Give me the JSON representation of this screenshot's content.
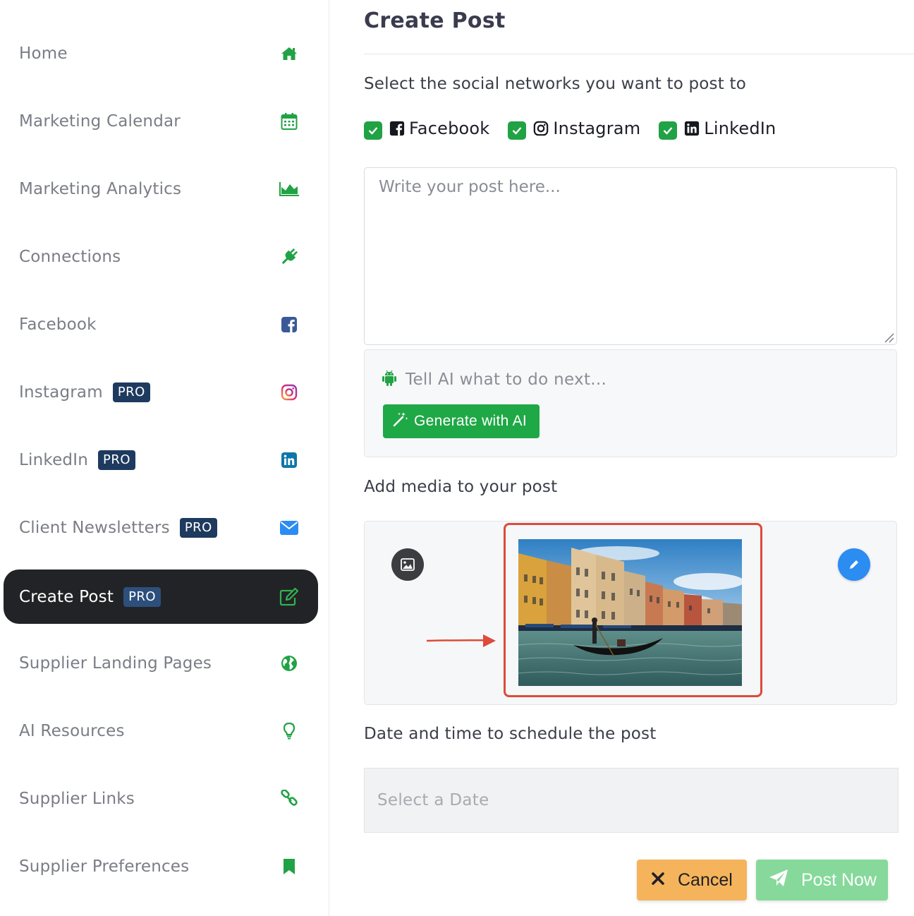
{
  "sidebar": {
    "items": [
      {
        "label": "Home",
        "icon": "home-icon",
        "pro": ""
      },
      {
        "label": "Marketing Calendar",
        "icon": "calendar-icon",
        "pro": ""
      },
      {
        "label": "Marketing Analytics",
        "icon": "area-chart-icon",
        "pro": ""
      },
      {
        "label": "Connections",
        "icon": "plug-icon",
        "pro": ""
      },
      {
        "label": "Facebook",
        "icon": "facebook-icon",
        "pro": ""
      },
      {
        "label": "Instagram",
        "icon": "instagram-icon",
        "pro": "PRO"
      },
      {
        "label": "LinkedIn",
        "icon": "linkedin-icon",
        "pro": "PRO"
      },
      {
        "label": "Client Newsletters",
        "icon": "envelope-icon",
        "pro": "PRO"
      },
      {
        "label": "Create Post",
        "icon": "edit-icon",
        "pro": "PRO",
        "active": true
      },
      {
        "label": "Supplier Landing Pages",
        "icon": "globe-icon",
        "pro": ""
      },
      {
        "label": "AI Resources",
        "icon": "lightbulb-icon",
        "pro": ""
      },
      {
        "label": "Supplier Links",
        "icon": "link-icon",
        "pro": ""
      },
      {
        "label": "Supplier Preferences",
        "icon": "bookmark-icon",
        "pro": ""
      }
    ]
  },
  "main": {
    "title": "Create Post",
    "networks_label": "Select the social networks you want to post to",
    "networks": [
      {
        "label": "Facebook",
        "checked": true,
        "icon": "facebook-square-icon"
      },
      {
        "label": "Instagram",
        "checked": true,
        "icon": "instagram-icon"
      },
      {
        "label": "LinkedIn",
        "checked": true,
        "icon": "linkedin-icon"
      }
    ],
    "post_placeholder": "Write your post here...",
    "ai": {
      "prompt_placeholder": "Tell AI what to do next...",
      "generate_label": "Generate with AI"
    },
    "media_label": "Add media to your post",
    "schedule_label": "Date and time to schedule the post",
    "date_placeholder": "Select a Date",
    "cancel_label": "Cancel",
    "post_now_label": "Post Now"
  },
  "colors": {
    "accent_green": "#21a244",
    "active_nav_bg": "#222326",
    "pro_badge_bg": "#1e3a5f",
    "highlight_red": "#dd4b3a",
    "cancel_bg": "#f5b45c",
    "post_now_bg": "#86d99a",
    "edit_blue": "#2b8cf2"
  }
}
